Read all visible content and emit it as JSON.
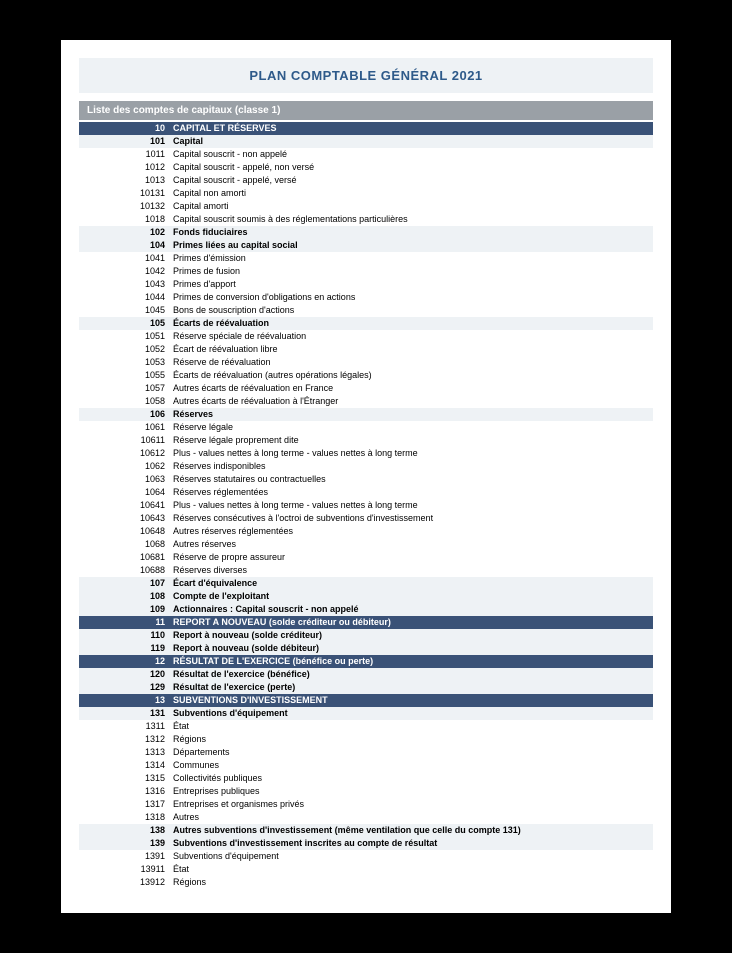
{
  "title": "PLAN COMPTABLE GÉNÉRAL 2021",
  "section_header": "Liste des comptes de capitaux (classe 1)",
  "rows": [
    {
      "code": "10",
      "label": "CAPITAL ET RÉSERVES",
      "level": 2
    },
    {
      "code": "101",
      "label": "Capital",
      "level": 3
    },
    {
      "code": "1011",
      "label": "Capital souscrit - non appelé",
      "level": 4
    },
    {
      "code": "1012",
      "label": "Capital souscrit - appelé, non versé",
      "level": 4
    },
    {
      "code": "1013",
      "label": "Capital souscrit - appelé, versé",
      "level": 4
    },
    {
      "code": "10131",
      "label": "Capital non amorti",
      "level": 5
    },
    {
      "code": "10132",
      "label": "Capital amorti",
      "level": 5
    },
    {
      "code": "1018",
      "label": "Capital souscrit soumis à des réglementations particulières",
      "level": 4
    },
    {
      "code": "102",
      "label": "Fonds fiduciaires",
      "level": 3
    },
    {
      "code": "104",
      "label": "Primes liées au capital social",
      "level": 3
    },
    {
      "code": "1041",
      "label": "Primes d'émission",
      "level": 4
    },
    {
      "code": "1042",
      "label": "Primes de fusion",
      "level": 4
    },
    {
      "code": "1043",
      "label": "Primes d'apport",
      "level": 4
    },
    {
      "code": "1044",
      "label": "Primes de conversion d'obligations en actions",
      "level": 4
    },
    {
      "code": "1045",
      "label": "Bons de souscription d'actions",
      "level": 4
    },
    {
      "code": "105",
      "label": "Écarts de réévaluation",
      "level": 3
    },
    {
      "code": "1051",
      "label": "Réserve spéciale de réévaluation",
      "level": 4
    },
    {
      "code": "1052",
      "label": "Écart de réévaluation libre",
      "level": 4
    },
    {
      "code": "1053",
      "label": "Réserve de réévaluation",
      "level": 4
    },
    {
      "code": "1055",
      "label": "Écarts de réévaluation (autres opérations légales)",
      "level": 4
    },
    {
      "code": "1057",
      "label": "Autres écarts de réévaluation en France",
      "level": 4
    },
    {
      "code": "1058",
      "label": "Autres écarts de réévaluation à l'Étranger",
      "level": 4
    },
    {
      "code": "106",
      "label": "Réserves",
      "level": 3
    },
    {
      "code": "1061",
      "label": "Réserve légale",
      "level": 4
    },
    {
      "code": "10611",
      "label": "Réserve légale proprement dite",
      "level": 5
    },
    {
      "code": "10612",
      "label": "Plus - values nettes à long terme - values nettes à long terme",
      "level": 5
    },
    {
      "code": "1062",
      "label": "Réserves indisponibles",
      "level": 4
    },
    {
      "code": "1063",
      "label": "Réserves statutaires ou contractuelles",
      "level": 4
    },
    {
      "code": "1064",
      "label": "Réserves réglementées",
      "level": 4
    },
    {
      "code": "10641",
      "label": "Plus - values nettes à long terme - values nettes à long terme",
      "level": 5
    },
    {
      "code": "10643",
      "label": "Réserves consécutives à l'octroi de subventions d'investissement",
      "level": 5
    },
    {
      "code": "10648",
      "label": "Autres réserves réglementées",
      "level": 5
    },
    {
      "code": "1068",
      "label": "Autres réserves",
      "level": 4
    },
    {
      "code": "10681",
      "label": "Réserve de propre assureur",
      "level": 5
    },
    {
      "code": "10688",
      "label": "Réserves diverses",
      "level": 5
    },
    {
      "code": "107",
      "label": "Écart d'équivalence",
      "level": 3
    },
    {
      "code": "108",
      "label": "Compte de l'exploitant",
      "level": 3
    },
    {
      "code": "109",
      "label": "Actionnaires : Capital souscrit - non appelé",
      "level": 3
    },
    {
      "code": "11",
      "label": "REPORT A NOUVEAU (solde créditeur ou débiteur)",
      "level": 2
    },
    {
      "code": "110",
      "label": "Report à nouveau (solde créditeur)",
      "level": 3
    },
    {
      "code": "119",
      "label": "Report à nouveau (solde débiteur)",
      "level": 3
    },
    {
      "code": "12",
      "label": "RÉSULTAT DE L'EXERCICE (bénéfice ou perte)",
      "level": 2
    },
    {
      "code": "120",
      "label": "Résultat de l'exercice (bénéfice)",
      "level": 3
    },
    {
      "code": "129",
      "label": "Résultat de l'exercice (perte)",
      "level": 3
    },
    {
      "code": "13",
      "label": "SUBVENTIONS D'INVESTISSEMENT",
      "level": 2
    },
    {
      "code": "131",
      "label": "Subventions d'équipement",
      "level": 3
    },
    {
      "code": "1311",
      "label": "État",
      "level": 4
    },
    {
      "code": "1312",
      "label": "Régions",
      "level": 4
    },
    {
      "code": "1313",
      "label": "Départements",
      "level": 4
    },
    {
      "code": "1314",
      "label": "Communes",
      "level": 4
    },
    {
      "code": "1315",
      "label": "Collectivités publiques",
      "level": 4
    },
    {
      "code": "1316",
      "label": "Entreprises publiques",
      "level": 4
    },
    {
      "code": "1317",
      "label": "Entreprises et organismes privés",
      "level": 4
    },
    {
      "code": "1318",
      "label": "Autres",
      "level": 4
    },
    {
      "code": "138",
      "label": "Autres subventions d'investissement (même ventilation que celle du compte 131)",
      "level": 3
    },
    {
      "code": "139",
      "label": "Subventions d'investissement inscrites au compte de résultat",
      "level": 3
    },
    {
      "code": "1391",
      "label": "Subventions d'équipement",
      "level": 4
    },
    {
      "code": "13911",
      "label": "État",
      "level": 5
    },
    {
      "code": "13912",
      "label": "Régions",
      "level": 5
    }
  ]
}
